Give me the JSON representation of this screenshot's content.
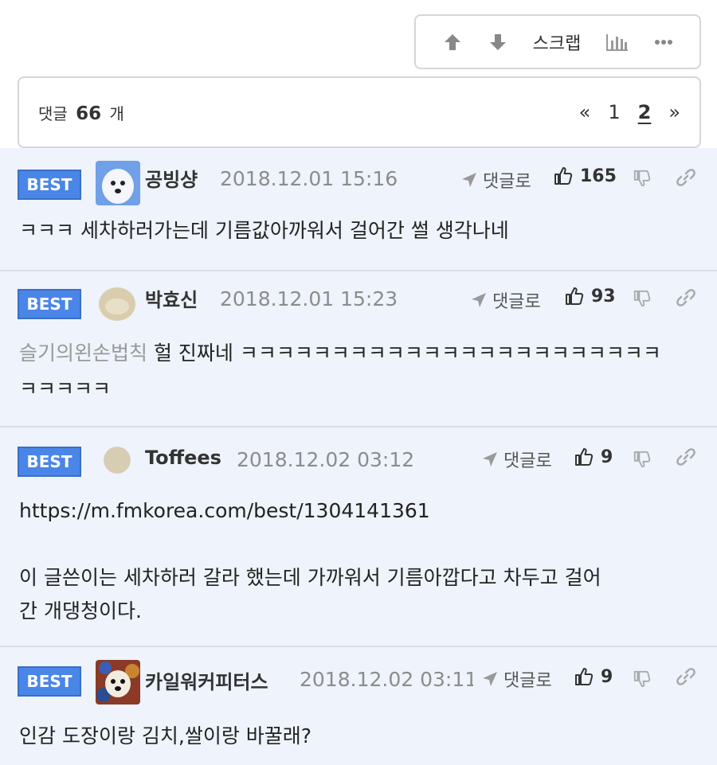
{
  "toolbar": {
    "upvote_icon": "arrow-up-icon",
    "downvote_icon": "arrow-down-icon",
    "scrap_label": "스크랩",
    "stats_icon": "bar-chart-icon",
    "more_icon": "more-dots-icon"
  },
  "comment_bar": {
    "prefix": "댓글",
    "count": "66",
    "suffix": "개",
    "pagination": {
      "prev": "«",
      "pages": [
        "1",
        "2"
      ],
      "current": "2",
      "next": "»"
    }
  },
  "comments": [
    {
      "badge": "BEST",
      "author": "공빙샹",
      "date": "2018.12.01 15:16",
      "reply_label": "댓글로",
      "votes": "165",
      "lines": [
        "ㅋㅋㅋ 세차하러가는데 기름값아까워서 걸어간 썰 생각나네"
      ]
    },
    {
      "badge": "BEST",
      "author": "박효신",
      "date": "2018.12.01 15:23",
      "reply_label": "댓글로",
      "votes": "93",
      "mention": "슬기의왼손법칙",
      "lines": [
        "헐 진짜네 ㅋㅋㅋㅋㅋㅋㅋㅋㅋㅋㅋㅋㅋㅋㅋㅋㅋㅋㅋㅋㅋㅋㅋ",
        "ㅋㅋㅋㅋㅋ"
      ]
    },
    {
      "badge": "BEST",
      "author": "Toffees",
      "date": "2018.12.02 03:12",
      "reply_label": "댓글로",
      "votes": "9",
      "lines": [
        "https://m.fmkorea.com/best/1304141361",
        "",
        "이 글쓴이는 세차하러 갈라 했는데 가까워서 기름아깝다고 차두고 걸어",
        "간 개댕청이다."
      ]
    },
    {
      "badge": "BEST",
      "author": "카일워커피터스",
      "date": "2018.12.02 03:11",
      "reply_label": "댓글로",
      "votes": "9",
      "lines": [
        "인감 도장이랑 김치,쌀이랑 바꿀래?"
      ]
    }
  ]
}
